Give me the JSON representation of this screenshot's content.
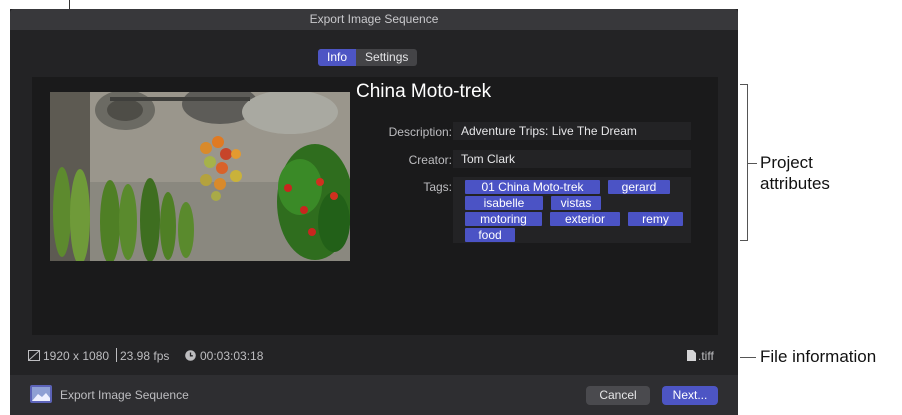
{
  "window": {
    "title": "Export Image Sequence"
  },
  "tabs": [
    {
      "label": "Info",
      "active": true
    },
    {
      "label": "Settings",
      "active": false
    }
  ],
  "project": {
    "name": "China Moto-trek",
    "fields": [
      {
        "label": "Description:",
        "value": "Adventure Trips: Live The Dream"
      },
      {
        "label": "Creator:",
        "value": "Tom Clark"
      }
    ],
    "tags_label": "Tags:",
    "tags": [
      "01 China Moto-trek",
      "gerard",
      "isabelle",
      "vistas",
      "motoring",
      "exterior",
      "remy",
      "food"
    ]
  },
  "file_info": {
    "resolution": "1920 x 1080",
    "frame_rate": "23.98 fps",
    "duration": "00:03:03:18",
    "format": ".tiff"
  },
  "footer": {
    "label": "Export Image Sequence",
    "cancel": "Cancel",
    "next": "Next..."
  },
  "callouts": {
    "project_attributes": "Project\nattributes",
    "file_information": "File information"
  },
  "colors": {
    "accent": "#4d55c4",
    "dialog_bg": "#232325"
  },
  "icons": [
    "aspect-icon",
    "clock-icon",
    "file-icon",
    "export-thumbnail-icon"
  ]
}
